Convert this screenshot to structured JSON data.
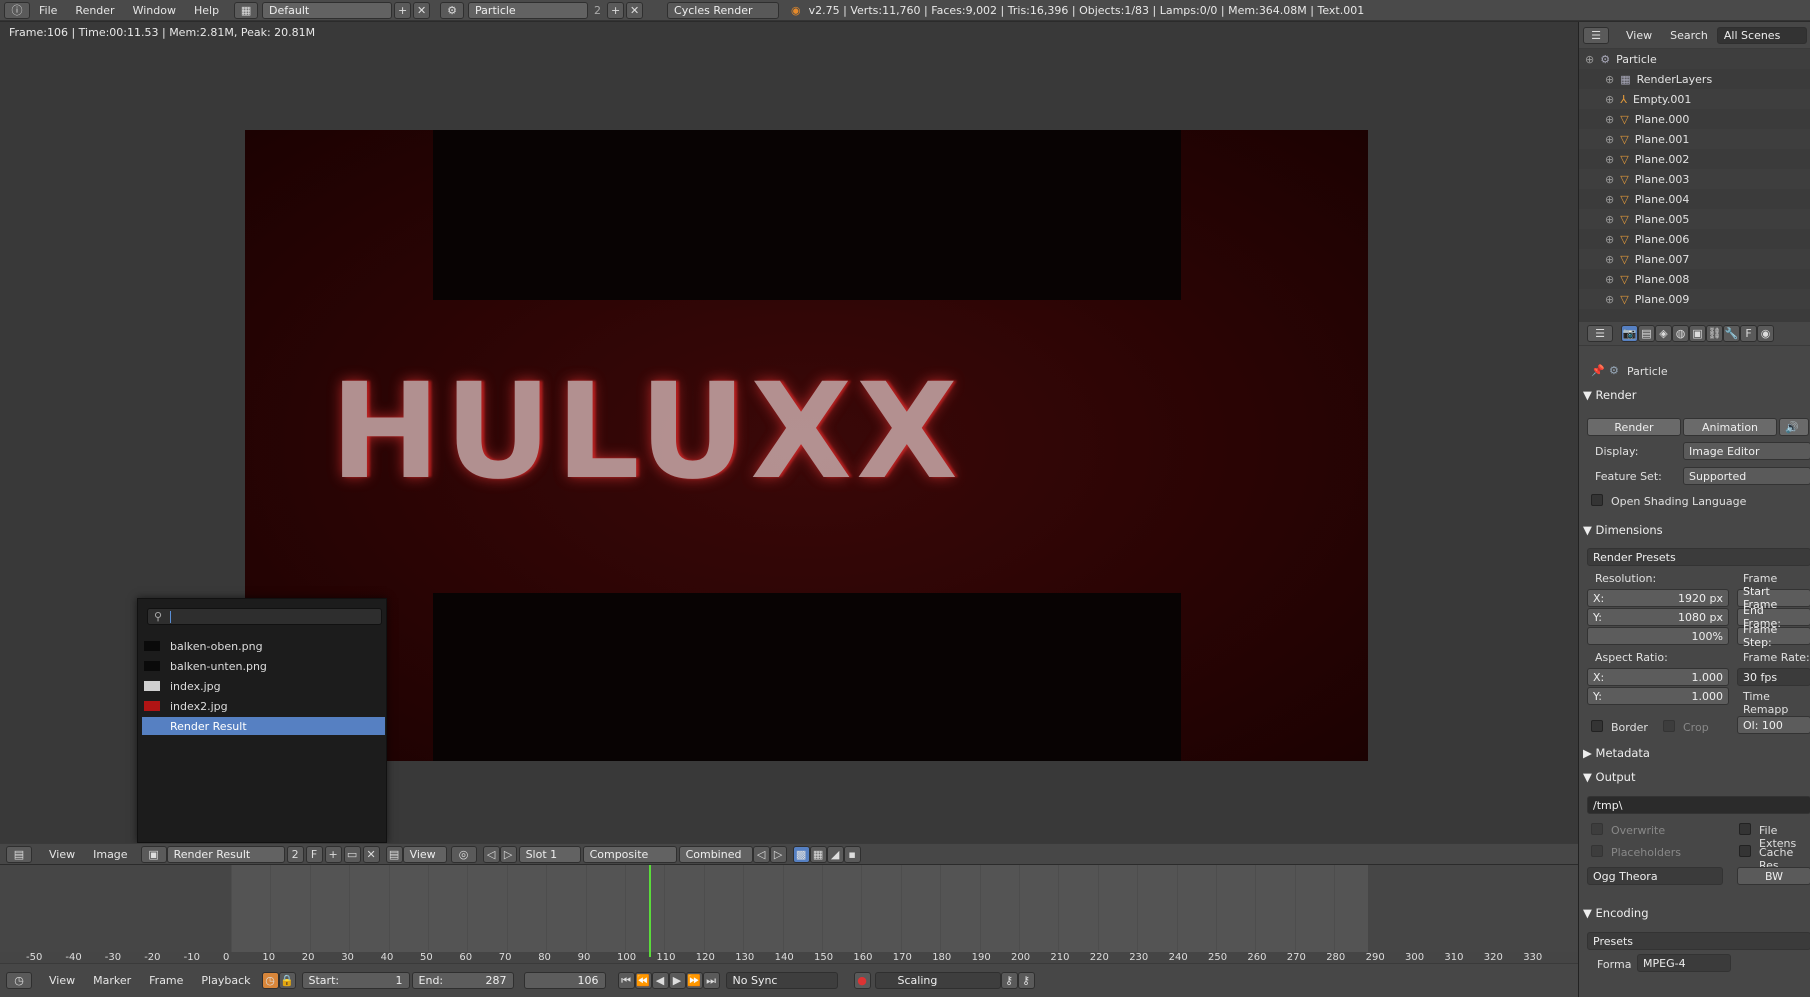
{
  "topbar": {
    "menus": [
      "File",
      "Render",
      "Window",
      "Help"
    ],
    "layout": "Default",
    "scene": "Particle",
    "scene_users": "2",
    "engine": "Cycles Render",
    "stats": "v2.75 | Verts:11,760 | Faces:9,002 | Tris:16,396 | Objects:1/83 | Lamps:0/0 | Mem:364.08M | Text.001"
  },
  "image_editor": {
    "info": "Frame:106 | Time:00:11.53 | Mem:2.81M, Peak: 20.81M",
    "render_text": "HULUXX",
    "popup": {
      "search_value": "",
      "items": [
        {
          "label": "balken-oben.png",
          "thumb": "#0a0a0a"
        },
        {
          "label": "balken-unten.png",
          "thumb": "#0a0a0a"
        },
        {
          "label": "index.jpg",
          "thumb": "#cfcfcf"
        },
        {
          "label": "index2.jpg",
          "thumb": "#b01414"
        },
        {
          "label": "Render Result",
          "thumb": "",
          "selected": true
        }
      ]
    },
    "header": {
      "view": "View",
      "image": "Image",
      "image_name": "Render Result",
      "users": "2",
      "fake": "F",
      "view2": "View",
      "slot": "Slot 1",
      "layer": "Composite",
      "pass": "Combined"
    }
  },
  "timeline": {
    "ticks": [
      "-50",
      "-40",
      "-30",
      "-20",
      "-10",
      "0",
      "10",
      "20",
      "30",
      "40",
      "50",
      "60",
      "70",
      "80",
      "90",
      "100",
      "110",
      "120",
      "130",
      "140",
      "150",
      "160",
      "170",
      "180",
      "190",
      "200",
      "210",
      "220",
      "230",
      "240",
      "250",
      "260",
      "270",
      "280",
      "290",
      "300",
      "310",
      "320",
      "330"
    ],
    "current_frame": 106,
    "header": {
      "view": "View",
      "marker": "Marker",
      "frame": "Frame",
      "playback": "Playback",
      "start_label": "Start:",
      "start": "1",
      "end_label": "End:",
      "end": "287",
      "current": "106",
      "sync": "No Sync",
      "keying": "Scaling"
    }
  },
  "outliner": {
    "view": "View",
    "search": "Search",
    "filter": "All Scenes",
    "items": [
      "Particle",
      "RenderLayers",
      "Empty.001",
      "Plane.000",
      "Plane.001",
      "Plane.002",
      "Plane.003",
      "Plane.004",
      "Plane.005",
      "Plane.006",
      "Plane.007",
      "Plane.008",
      "Plane.009"
    ]
  },
  "properties": {
    "context": "Particle",
    "render_section": "Render",
    "render_btn": "Render",
    "animation_btn": "Animation",
    "display_label": "Display:",
    "display_value": "Image Editor",
    "feature_label": "Feature Set:",
    "feature_value": "Supported",
    "osl": "Open Shading Language",
    "dimensions_section": "Dimensions",
    "render_presets": "Render Presets",
    "resolution_label": "Resolution:",
    "res_x_label": "X:",
    "res_x": "1920 px",
    "res_y_label": "Y:",
    "res_y": "1080 px",
    "res_pct": "100%",
    "frame_range_label": "Frame Range",
    "start_frame": "Start Frame",
    "end_frame": "End Frame:",
    "frame_step": "Frame Step:",
    "aspect_label": "Aspect Ratio:",
    "aspect_x_label": "X:",
    "aspect_x": "1.000",
    "aspect_y_label": "Y:",
    "aspect_y": "1.000",
    "frame_rate_label": "Frame Rate:",
    "frame_rate": "30 fps",
    "time_remap": "Time Remapp",
    "old_value": "Ol: 100",
    "border": "Border",
    "crop": "Crop",
    "metadata_section": "Metadata",
    "output_section": "Output",
    "output_path": "/tmp\\",
    "overwrite": "Overwrite",
    "file_ext": "File Extens",
    "placeholders": "Placeholders",
    "cache_result": "Cache Res",
    "format": "Ogg Theora",
    "bw": "BW",
    "encoding_section": "Encoding",
    "presets": "Presets",
    "forma_label": "Forma",
    "forma_value": "MPEG-4"
  }
}
